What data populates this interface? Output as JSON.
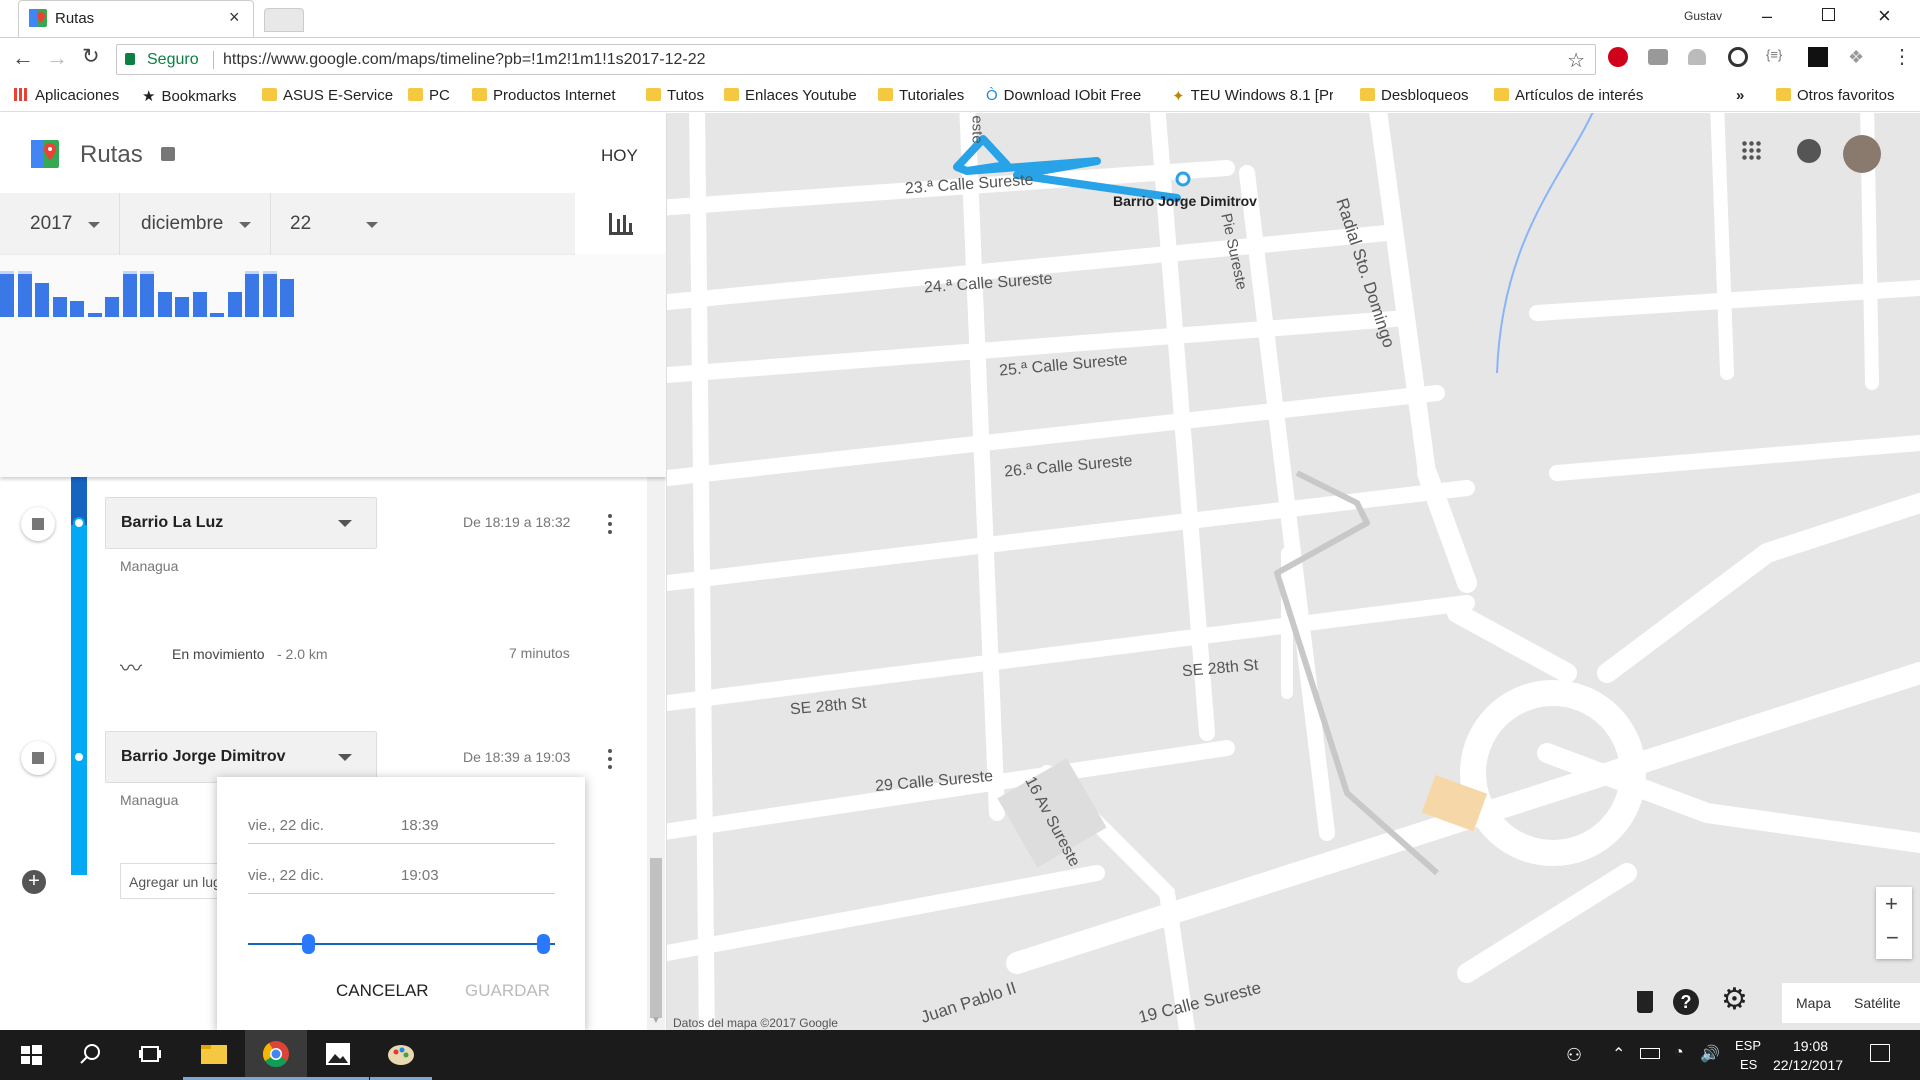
{
  "window": {
    "user": "Gustav",
    "tab_title": "Rutas"
  },
  "toolbar": {
    "secure_label": "Seguro",
    "url": "https://www.google.com/maps/timeline?pb=!1m2!1m1!1s2017-12-22"
  },
  "bookmarks": [
    {
      "label": "Aplicaciones"
    },
    {
      "label": "Bookmarks"
    },
    {
      "label": "ASUS E-Service"
    },
    {
      "label": "PC"
    },
    {
      "label": "Productos Internet"
    },
    {
      "label": "Tutos"
    },
    {
      "label": "Enlaces Youtube"
    },
    {
      "label": "Tutoriales"
    },
    {
      "label": "Download IObit Free"
    },
    {
      "label": "TEU Windows 8.1 [Pr"
    },
    {
      "label": "Desbloqueos"
    },
    {
      "label": "Artículos de interés"
    },
    {
      "label": "Otros favoritos"
    }
  ],
  "panel": {
    "title": "Rutas",
    "today": "HOY",
    "year": "2017",
    "month": "diciembre",
    "day": "22",
    "histogram": [
      0.95,
      0.95,
      0.75,
      0.45,
      0.35,
      0.1,
      0.45,
      0.95,
      0.95,
      0.55,
      0.45,
      0.55,
      0.1,
      0.55,
      0.95,
      0.95,
      0.85
    ],
    "histogram_colors": {
      "active": "#3b78e7",
      "inactive": "#c6d6f3"
    },
    "timeline": [
      {
        "place": "Barrio La Luz",
        "city": "Managua",
        "time": "De 18:19 a 18:32"
      },
      {
        "activity": "En movimiento",
        "distance": "- 2.0 km",
        "duration": "7 minutos"
      },
      {
        "place": "Barrio Jorge Dimitrov",
        "city": "Managua",
        "time": "De 18:39 a 19:03"
      }
    ],
    "add_place": "Agregar un lug"
  },
  "editor": {
    "start_date": "vie., 22 dic.",
    "start_time": "18:39",
    "end_date": "vie., 22 dic.",
    "end_time": "19:03",
    "cancel": "CANCELAR",
    "save": "GUARDAR"
  },
  "map": {
    "streets": [
      "23.ª Calle Sureste",
      "24.ª Calle Sureste",
      "25.ª Calle Sureste",
      "26.ª Calle Sureste",
      "SE 28th St",
      "SE 28th St",
      "29 Calle Sureste",
      "16 Av Sureste",
      "Radial Sto. Domingo",
      "Juan Pablo II",
      "19 Calle Sureste",
      "Pie Sureste",
      "este"
    ],
    "pin_label": "Barrio Jorge Dimitrov",
    "attribution": "Datos del mapa ©2017 Google",
    "zoom_in": "+",
    "zoom_out": "−",
    "type_map": "Mapa",
    "type_satellite": "Satélite",
    "colors": {
      "route": "#29a3e8",
      "path": "#c8c8c8"
    }
  },
  "taskbar": {
    "lang1": "ESP",
    "lang2": "ES",
    "time": "19:08",
    "date": "22/12/2017"
  }
}
